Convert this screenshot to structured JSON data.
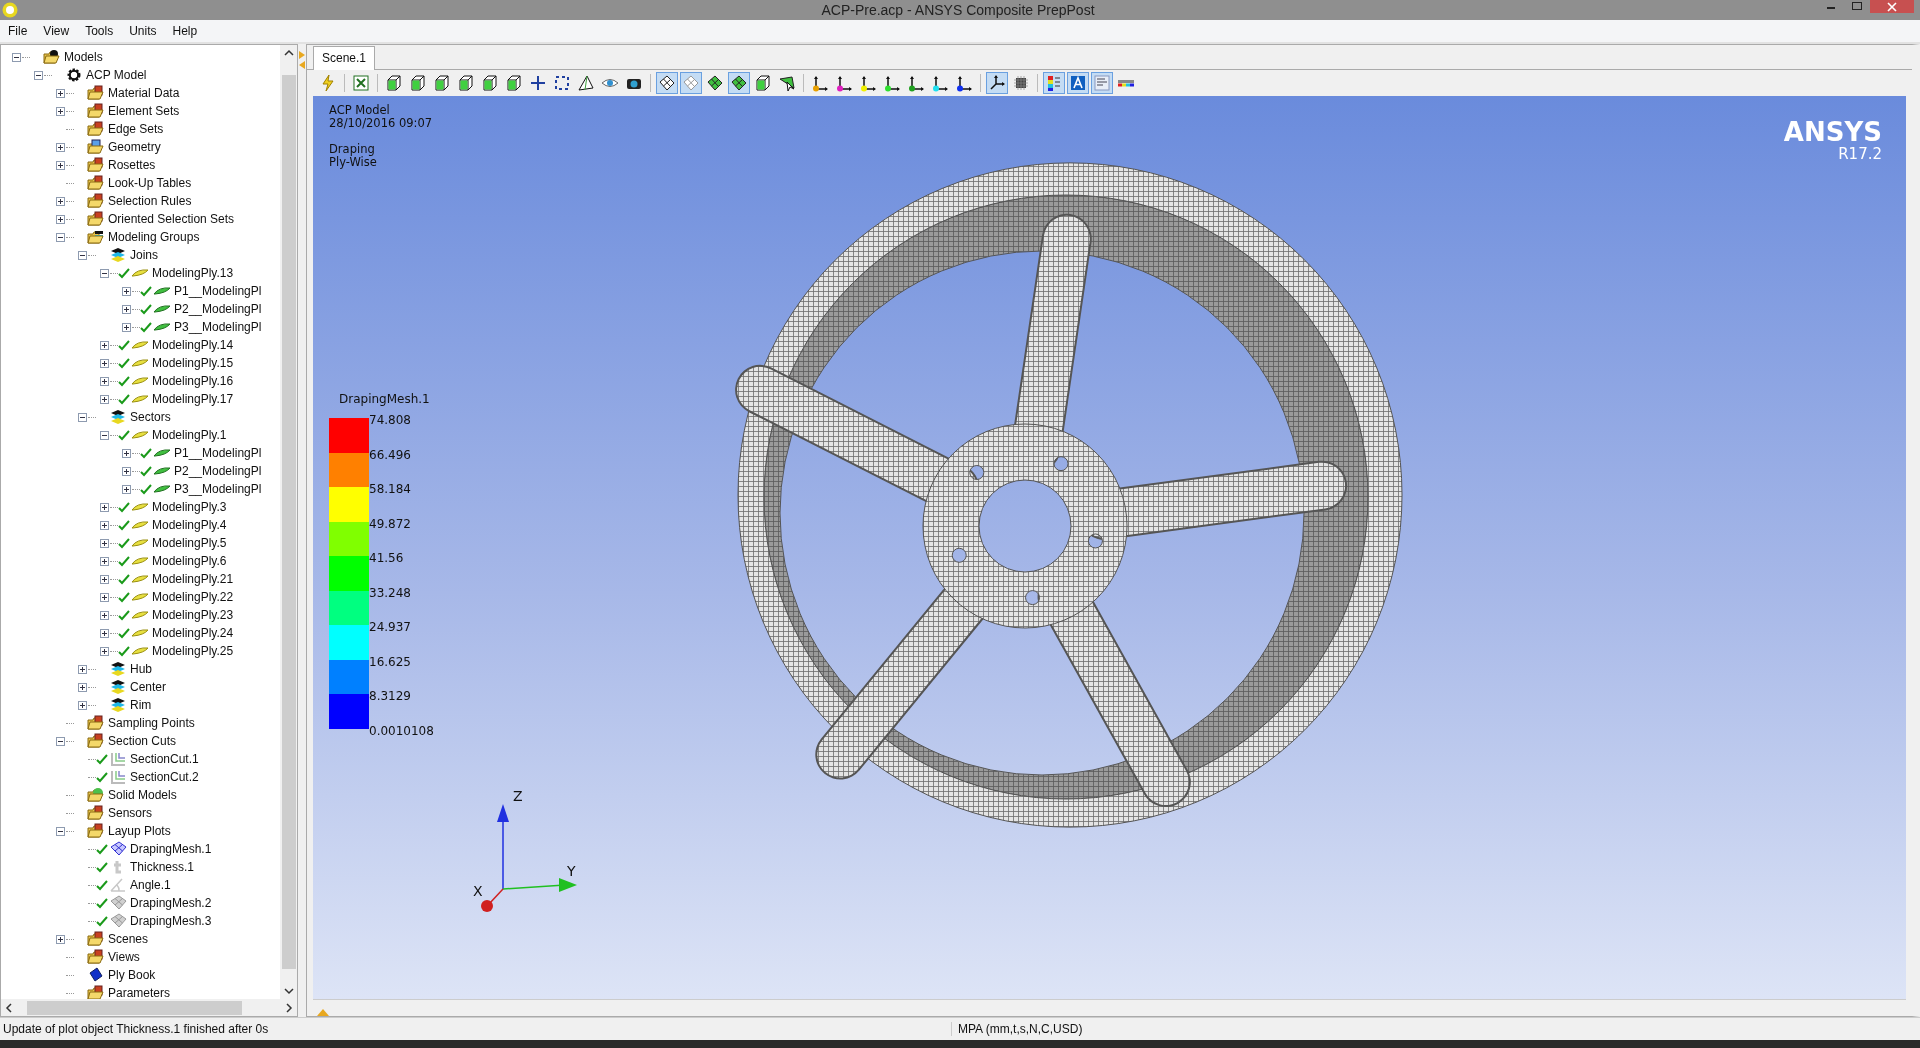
{
  "window": {
    "title": "ACP-Pre.acp - ANSYS Composite PrepPost"
  },
  "menu": [
    "File",
    "View",
    "Tools",
    "Units",
    "Help"
  ],
  "tree": [
    {
      "label": "Models",
      "kind": "gearfolder",
      "expanded": true,
      "children": [
        {
          "label": "ACP Model",
          "kind": "gear",
          "expanded": true,
          "children": [
            {
              "label": "Material Data",
              "kind": "folder",
              "expanded": false
            },
            {
              "label": "Element Sets",
              "kind": "folder",
              "expanded": false
            },
            {
              "label": "Edge Sets",
              "kind": "folder"
            },
            {
              "label": "Geometry",
              "kind": "geometry",
              "expanded": false
            },
            {
              "label": "Rosettes",
              "kind": "folder",
              "expanded": false
            },
            {
              "label": "Look-Up Tables",
              "kind": "folder"
            },
            {
              "label": "Selection Rules",
              "kind": "folder",
              "expanded": false
            },
            {
              "label": "Oriented Selection Sets",
              "kind": "folder",
              "expanded": false
            },
            {
              "label": "Modeling Groups",
              "kind": "groupfolder",
              "expanded": true,
              "children": [
                {
                  "label": "Joins",
                  "kind": "group",
                  "expanded": true,
                  "children": [
                    {
                      "label": "ModelingPly.13",
                      "kind": "ply",
                      "checked": true,
                      "expanded": true,
                      "children": [
                        {
                          "label": "P1__ModelingPl",
                          "kind": "subply",
                          "checked": true,
                          "expanded": false
                        },
                        {
                          "label": "P2__ModelingPl",
                          "kind": "subply",
                          "checked": true,
                          "expanded": false
                        },
                        {
                          "label": "P3__ModelingPl",
                          "kind": "subply",
                          "checked": true,
                          "expanded": false
                        }
                      ]
                    },
                    {
                      "label": "ModelingPly.14",
                      "kind": "ply",
                      "checked": true,
                      "expanded": false
                    },
                    {
                      "label": "ModelingPly.15",
                      "kind": "ply",
                      "checked": true,
                      "expanded": false
                    },
                    {
                      "label": "ModelingPly.16",
                      "kind": "ply",
                      "checked": true,
                      "expanded": false
                    },
                    {
                      "label": "ModelingPly.17",
                      "kind": "ply",
                      "checked": true,
                      "expanded": false
                    }
                  ]
                },
                {
                  "label": "Sectors",
                  "kind": "group",
                  "expanded": true,
                  "children": [
                    {
                      "label": "ModelingPly.1",
                      "kind": "ply",
                      "checked": true,
                      "expanded": true,
                      "children": [
                        {
                          "label": "P1__ModelingPl",
                          "kind": "subply",
                          "checked": true,
                          "expanded": false
                        },
                        {
                          "label": "P2__ModelingPl",
                          "kind": "subply",
                          "checked": true,
                          "expanded": false
                        },
                        {
                          "label": "P3__ModelingPl",
                          "kind": "subply",
                          "checked": true,
                          "expanded": false
                        }
                      ]
                    },
                    {
                      "label": "ModelingPly.3",
                      "kind": "ply",
                      "checked": true,
                      "expanded": false
                    },
                    {
                      "label": "ModelingPly.4",
                      "kind": "ply",
                      "checked": true,
                      "expanded": false
                    },
                    {
                      "label": "ModelingPly.5",
                      "kind": "ply",
                      "checked": true,
                      "expanded": false
                    },
                    {
                      "label": "ModelingPly.6",
                      "kind": "ply",
                      "checked": true,
                      "expanded": false
                    },
                    {
                      "label": "ModelingPly.21",
                      "kind": "ply",
                      "checked": true,
                      "expanded": false
                    },
                    {
                      "label": "ModelingPly.22",
                      "kind": "ply",
                      "checked": true,
                      "expanded": false
                    },
                    {
                      "label": "ModelingPly.23",
                      "kind": "ply",
                      "checked": true,
                      "expanded": false
                    },
                    {
                      "label": "ModelingPly.24",
                      "kind": "ply",
                      "checked": true,
                      "expanded": false
                    },
                    {
                      "label": "ModelingPly.25",
                      "kind": "ply",
                      "checked": true,
                      "expanded": false
                    }
                  ]
                },
                {
                  "label": "Hub",
                  "kind": "group",
                  "expanded": false
                },
                {
                  "label": "Center",
                  "kind": "group",
                  "expanded": false
                },
                {
                  "label": "Rim",
                  "kind": "group",
                  "expanded": false
                }
              ]
            },
            {
              "label": "Sampling Points",
              "kind": "folder"
            },
            {
              "label": "Section Cuts",
              "kind": "folder",
              "expanded": true,
              "children": [
                {
                  "label": "SectionCut.1",
                  "kind": "cut",
                  "checked": true
                },
                {
                  "label": "SectionCut.2",
                  "kind": "cut",
                  "checked": true
                }
              ]
            },
            {
              "label": "Solid Models",
              "kind": "solidfolder"
            },
            {
              "label": "Sensors",
              "kind": "folder"
            },
            {
              "label": "Layup Plots",
              "kind": "folder",
              "expanded": true,
              "children": [
                {
                  "label": "DrapingMesh.1",
                  "kind": "mesh",
                  "checked": true
                },
                {
                  "label": "Thickness.1",
                  "kind": "thickness",
                  "checked": true
                },
                {
                  "label": "Angle.1",
                  "kind": "angle",
                  "checked": true
                },
                {
                  "label": "DrapingMesh.2",
                  "kind": "meshgrey",
                  "checked": true
                },
                {
                  "label": "DrapingMesh.3",
                  "kind": "meshgrey",
                  "checked": true
                }
              ]
            },
            {
              "label": "Scenes",
              "kind": "folder",
              "expanded": false
            },
            {
              "label": "Views",
              "kind": "folder"
            },
            {
              "label": "Ply Book",
              "kind": "book"
            },
            {
              "label": "Parameters",
              "kind": "folder"
            }
          ]
        }
      ]
    }
  ],
  "tabs": [
    {
      "label": "Scene.1",
      "selected": true
    }
  ],
  "toolbar": [
    {
      "kind": "bolt",
      "on": false
    },
    {
      "kind": "sep"
    },
    {
      "kind": "excel",
      "on": false
    },
    {
      "kind": "sep"
    },
    {
      "kind": "cube",
      "on": false
    },
    {
      "kind": "cube",
      "on": false
    },
    {
      "kind": "cube",
      "on": false
    },
    {
      "kind": "cube",
      "on": false
    },
    {
      "kind": "cube",
      "on": false
    },
    {
      "kind": "cube",
      "on": false
    },
    {
      "kind": "fit",
      "on": false
    },
    {
      "kind": "frame",
      "on": false
    },
    {
      "kind": "prism",
      "on": false
    },
    {
      "kind": "eye",
      "on": false
    },
    {
      "kind": "camera",
      "on": false
    },
    {
      "kind": "sep"
    },
    {
      "kind": "mesh",
      "on": true
    },
    {
      "kind": "meshflat",
      "on": true
    },
    {
      "kind": "meshgreen",
      "on": false
    },
    {
      "kind": "meshgreen",
      "on": true
    },
    {
      "kind": "cubegreen",
      "on": false
    },
    {
      "kind": "pick",
      "on": false
    },
    {
      "kind": "sep"
    },
    {
      "kind": "axes",
      "on": false,
      "color": "#e8a000"
    },
    {
      "kind": "axes",
      "on": false,
      "color": "#e020c0"
    },
    {
      "kind": "axes",
      "on": false,
      "color": "#f0f000"
    },
    {
      "kind": "axes",
      "on": false,
      "color": "#30e030"
    },
    {
      "kind": "axes",
      "on": false,
      "color": "#20a020"
    },
    {
      "kind": "axes",
      "on": false,
      "color": "#20e0f0"
    },
    {
      "kind": "axes",
      "on": false,
      "color": "#1030f0"
    },
    {
      "kind": "sep"
    },
    {
      "kind": "triad",
      "on": true
    },
    {
      "kind": "chip",
      "on": false
    },
    {
      "kind": "sep"
    },
    {
      "kind": "legend",
      "on": true
    },
    {
      "kind": "texta",
      "on": true
    },
    {
      "kind": "info",
      "on": true
    },
    {
      "kind": "colorbar",
      "on": false
    }
  ],
  "scene": {
    "info": [
      "ACP Model",
      "28/10/2016 09:07"
    ],
    "plot": [
      "Draping",
      "Ply-Wise"
    ],
    "logo": {
      "name": "ANSYS",
      "version": "R17.2"
    },
    "legend": {
      "title": "DrapingMesh.1",
      "bands": [
        {
          "color": "#ff0000"
        },
        {
          "color": "#ff8000"
        },
        {
          "color": "#ffff00"
        },
        {
          "color": "#80ff00"
        },
        {
          "color": "#00ff00"
        },
        {
          "color": "#00ff80"
        },
        {
          "color": "#00ffff"
        },
        {
          "color": "#0080ff"
        },
        {
          "color": "#0000ff"
        }
      ],
      "labels": [
        "74.808",
        "66.496",
        "58.184",
        "49.872",
        "41.56",
        "33.248",
        "24.937",
        "16.625",
        "8.3129",
        "0.0010108"
      ]
    },
    "triad": {
      "x": "X",
      "y": "Y",
      "z": "Z"
    }
  },
  "status_bar": {
    "message": "Update of plot object Thickness.1 finished after 0s",
    "units": "MPA (mm,t,s,N,C,USD)"
  }
}
